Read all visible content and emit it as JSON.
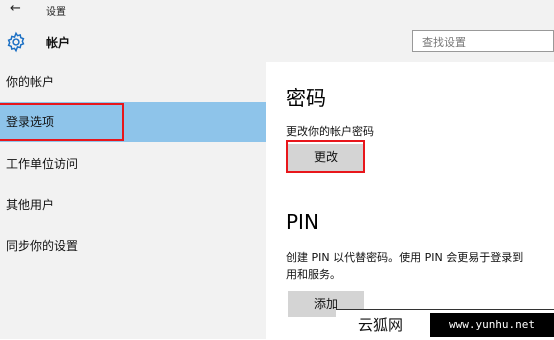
{
  "window": {
    "title": "设置"
  },
  "header": {
    "title": "帐户",
    "search_placeholder": "查找设置"
  },
  "sidebar": {
    "items": [
      {
        "label": "你的帐户"
      },
      {
        "label": "登录选项"
      },
      {
        "label": "工作单位访问"
      },
      {
        "label": "其他用户"
      },
      {
        "label": "同步你的设置"
      }
    ],
    "selected": "登录选项"
  },
  "password": {
    "title": "密码",
    "description": "更改你的帐户密码",
    "button": "更改"
  },
  "pin": {
    "title": "PIN",
    "description_line1": "创建 PIN 以代替密码。使用 PIN 会更易于登录到",
    "description_line2": "用和服务。",
    "button": "添加"
  },
  "watermark": {
    "text": "云狐网",
    "url": "www.yunhu.net"
  },
  "colors": {
    "selected_bg": "#8ec4ea",
    "highlight_outline": "#e8161b",
    "button_bg": "#d4d4d4"
  }
}
